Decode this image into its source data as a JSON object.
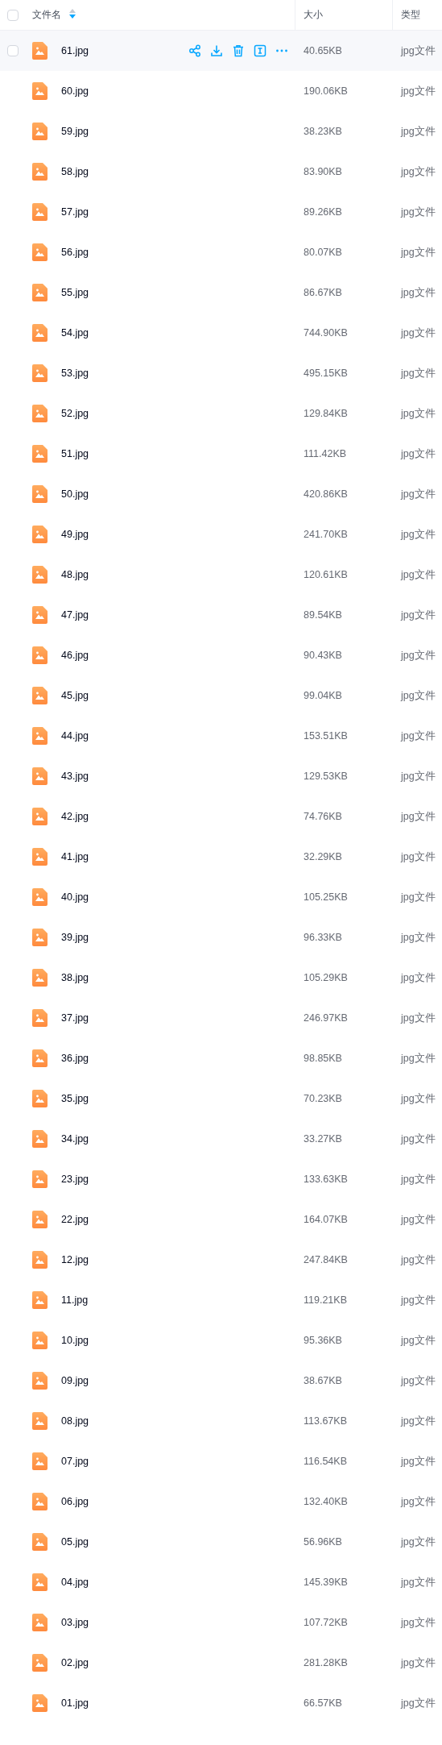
{
  "table": {
    "select_all_checked": false,
    "columns": [
      {
        "label": "文件名",
        "sorted_descending": true
      },
      {
        "label": "大小"
      },
      {
        "label": "类型"
      }
    ],
    "rows": [
      {
        "name": "61.jpg",
        "size": "40.65KB",
        "type": "jpg文件",
        "hovered": true,
        "checked": false
      },
      {
        "name": "60.jpg",
        "size": "190.06KB",
        "type": "jpg文件",
        "hovered": false
      },
      {
        "name": "59.jpg",
        "size": "38.23KB",
        "type": "jpg文件",
        "hovered": false
      },
      {
        "name": "58.jpg",
        "size": "83.90KB",
        "type": "jpg文件",
        "hovered": false
      },
      {
        "name": "57.jpg",
        "size": "89.26KB",
        "type": "jpg文件",
        "hovered": false
      },
      {
        "name": "56.jpg",
        "size": "80.07KB",
        "type": "jpg文件",
        "hovered": false
      },
      {
        "name": "55.jpg",
        "size": "86.67KB",
        "type": "jpg文件",
        "hovered": false
      },
      {
        "name": "54.jpg",
        "size": "744.90KB",
        "type": "jpg文件",
        "hovered": false
      },
      {
        "name": "53.jpg",
        "size": "495.15KB",
        "type": "jpg文件",
        "hovered": false
      },
      {
        "name": "52.jpg",
        "size": "129.84KB",
        "type": "jpg文件",
        "hovered": false
      },
      {
        "name": "51.jpg",
        "size": "111.42KB",
        "type": "jpg文件",
        "hovered": false
      },
      {
        "name": "50.jpg",
        "size": "420.86KB",
        "type": "jpg文件",
        "hovered": false
      },
      {
        "name": "49.jpg",
        "size": "241.70KB",
        "type": "jpg文件",
        "hovered": false
      },
      {
        "name": "48.jpg",
        "size": "120.61KB",
        "type": "jpg文件",
        "hovered": false
      },
      {
        "name": "47.jpg",
        "size": "89.54KB",
        "type": "jpg文件",
        "hovered": false
      },
      {
        "name": "46.jpg",
        "size": "90.43KB",
        "type": "jpg文件",
        "hovered": false
      },
      {
        "name": "45.jpg",
        "size": "99.04KB",
        "type": "jpg文件",
        "hovered": false
      },
      {
        "name": "44.jpg",
        "size": "153.51KB",
        "type": "jpg文件",
        "hovered": false
      },
      {
        "name": "43.jpg",
        "size": "129.53KB",
        "type": "jpg文件",
        "hovered": false
      },
      {
        "name": "42.jpg",
        "size": "74.76KB",
        "type": "jpg文件",
        "hovered": false
      },
      {
        "name": "41.jpg",
        "size": "32.29KB",
        "type": "jpg文件",
        "hovered": false
      },
      {
        "name": "40.jpg",
        "size": "105.25KB",
        "type": "jpg文件",
        "hovered": false
      },
      {
        "name": "39.jpg",
        "size": "96.33KB",
        "type": "jpg文件",
        "hovered": false
      },
      {
        "name": "38.jpg",
        "size": "105.29KB",
        "type": "jpg文件",
        "hovered": false
      },
      {
        "name": "37.jpg",
        "size": "246.97KB",
        "type": "jpg文件",
        "hovered": false
      },
      {
        "name": "36.jpg",
        "size": "98.85KB",
        "type": "jpg文件",
        "hovered": false
      },
      {
        "name": "35.jpg",
        "size": "70.23KB",
        "type": "jpg文件",
        "hovered": false
      },
      {
        "name": "34.jpg",
        "size": "33.27KB",
        "type": "jpg文件",
        "hovered": false
      },
      {
        "name": "23.jpg",
        "size": "133.63KB",
        "type": "jpg文件",
        "hovered": false
      },
      {
        "name": "22.jpg",
        "size": "164.07KB",
        "type": "jpg文件",
        "hovered": false
      },
      {
        "name": "12.jpg",
        "size": "247.84KB",
        "type": "jpg文件",
        "hovered": false
      },
      {
        "name": "11.jpg",
        "size": "119.21KB",
        "type": "jpg文件",
        "hovered": false
      },
      {
        "name": "10.jpg",
        "size": "95.36KB",
        "type": "jpg文件",
        "hovered": false
      },
      {
        "name": "09.jpg",
        "size": "38.67KB",
        "type": "jpg文件",
        "hovered": false
      },
      {
        "name": "08.jpg",
        "size": "113.67KB",
        "type": "jpg文件",
        "hovered": false
      },
      {
        "name": "07.jpg",
        "size": "116.54KB",
        "type": "jpg文件",
        "hovered": false
      },
      {
        "name": "06.jpg",
        "size": "132.40KB",
        "type": "jpg文件",
        "hovered": false
      },
      {
        "name": "05.jpg",
        "size": "56.96KB",
        "type": "jpg文件",
        "hovered": false
      },
      {
        "name": "04.jpg",
        "size": "145.39KB",
        "type": "jpg文件",
        "hovered": false
      },
      {
        "name": "03.jpg",
        "size": "107.72KB",
        "type": "jpg文件",
        "hovered": false
      },
      {
        "name": "02.jpg",
        "size": "281.28KB",
        "type": "jpg文件",
        "hovered": false
      },
      {
        "name": "01.jpg",
        "size": "66.57KB",
        "type": "jpg文件",
        "hovered": false
      }
    ]
  }
}
